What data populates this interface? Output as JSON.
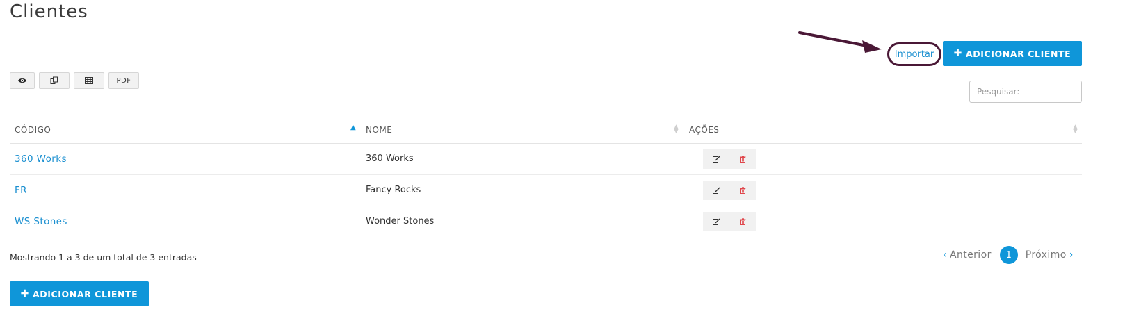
{
  "page_title": "Clientes",
  "actions": {
    "import_label": "Importar",
    "add_client_label": "ADICIONAR CLIENTE",
    "add_icon": "plus-icon"
  },
  "toolbar": {
    "buttons": [
      {
        "icon": "eye-icon"
      },
      {
        "icon": "copy-icon"
      },
      {
        "icon": "table-icon"
      },
      {
        "label": "PDF"
      }
    ]
  },
  "search": {
    "placeholder": "Pesquisar:"
  },
  "table": {
    "columns": [
      "CÓDIGO",
      "NOME",
      "AÇÕES"
    ],
    "sort": {
      "column": "CÓDIGO",
      "direction": "asc"
    },
    "rows": [
      {
        "code": "360 Works",
        "name": "360 Works"
      },
      {
        "code": "FR",
        "name": "Fancy Rocks"
      },
      {
        "code": "WS Stones",
        "name": "Wonder Stones"
      }
    ],
    "row_actions": [
      "edit-icon",
      "trash-icon"
    ]
  },
  "footer": {
    "info": "Mostrando 1 a 3 de um total de 3 entradas",
    "pagination": {
      "prev": "Anterior",
      "current": "1",
      "next": "Próximo"
    }
  },
  "colors": {
    "primary": "#0f96d9",
    "link": "#1a8fd0",
    "annotation": "#4a1836",
    "delete": "#e0474c"
  }
}
